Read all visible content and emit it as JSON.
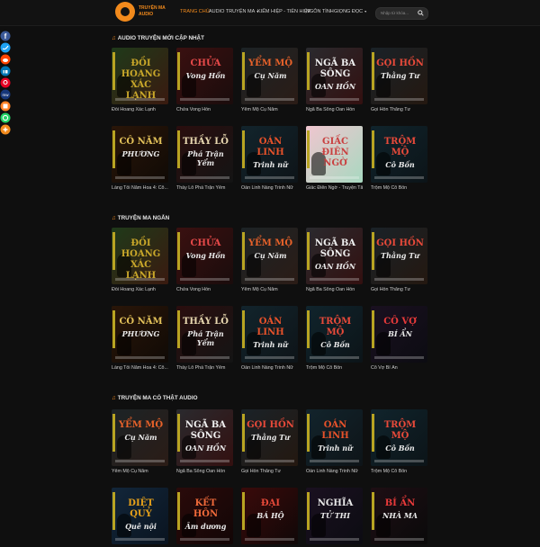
{
  "header": {
    "logo_line1": "TRUYỆN MA",
    "logo_line2": "AUDIO",
    "nav": [
      {
        "label": "TRANG CHỦ",
        "active": true,
        "dropdown": false
      },
      {
        "label": "AUDIO TRUYỆN MA",
        "active": false,
        "dropdown": true
      },
      {
        "label": "KIẾM HIỆP - TIÊN HIỆP",
        "active": false,
        "dropdown": false
      },
      {
        "label": "NGÔN TÌNH",
        "active": false,
        "dropdown": false
      },
      {
        "label": "GIỌNG ĐỌC",
        "active": false,
        "dropdown": true
      }
    ],
    "search_placeholder": "Nhập từ khóa..."
  },
  "share": [
    "facebook-icon",
    "twitter-icon",
    "reddit-icon",
    "linkedin-icon",
    "pinterest-icon",
    "mewe-icon",
    "mix-icon",
    "whatsapp-icon",
    "more-icon"
  ],
  "colors": {
    "accent": "#f28a1c",
    "background": "#0f0f0f"
  },
  "sections": [
    {
      "title": "AUDIO TRUYỆN MỚI CẬP NHẬT",
      "rows": [
        [
          {
            "caption": "Đồi Hoang Xác Lạnh",
            "art": "ĐỒI HOANG XÁC LẠNH",
            "art_sub": "",
            "color": "#c9a72a",
            "bg1": "#1f3a1a",
            "bg2": "#3a1a10"
          },
          {
            "caption": "Chửa Vong Hồn",
            "art": "CHỬA",
            "art_sub": "Vong Hồn",
            "color": "#e84a4a",
            "bg1": "#3a1010",
            "bg2": "#1a0c0c"
          },
          {
            "caption": "Yểm Mộ Cụ Năm",
            "art": "YỂM MỘ",
            "art_sub": "Cụ Năm",
            "color": "#e8622a",
            "bg1": "#1c2326",
            "bg2": "#2b1c16"
          },
          {
            "caption": "Ngã Ba Sông Oan Hồn",
            "art": "NGÃ BA SÔNG",
            "art_sub": "OAN HỒN",
            "color": "#f0f0f0",
            "bg1": "#2a2a2e",
            "bg2": "#331010"
          },
          {
            "caption": "Gọi Hồn Thằng Tư",
            "art": "GỌI HỒN",
            "art_sub": "Thằng Tư",
            "color": "#e84a3a",
            "bg1": "#1a2228",
            "bg2": "#241810"
          }
        ],
        [
          {
            "caption": "Làng Tối Năm Hoa 4: Cô...",
            "art": "CÔ NĂM",
            "art_sub": "PHƯƠNG",
            "color": "#e2c15a",
            "bg1": "#2a1608",
            "bg2": "#100a06"
          },
          {
            "caption": "Thầy Lỗ Phá Trận Yểm",
            "art": "THẦY LỖ",
            "art_sub": "Phá Trận Yểm",
            "color": "#e8d8b0",
            "bg1": "#2a0e0e",
            "bg2": "#141414"
          },
          {
            "caption": "Oán Linh Nàng Trinh Nữ",
            "art": "OÁN LINH",
            "art_sub": "Trinh nữ",
            "color": "#e8522a",
            "bg1": "#12242c",
            "bg2": "#0e1418"
          },
          {
            "caption": "Giấc Điên Ngờ - Truyện Tâ...",
            "art": "GIẤC ĐIÊN NGỜ",
            "art_sub": "",
            "color": "#c94040",
            "bg1": "#f0c6cf",
            "bg2": "#a8d8c0"
          },
          {
            "caption": "Trộm Mộ Cô Bốn",
            "art": "TRỘM MỘ",
            "art_sub": "Cô Bốn",
            "color": "#e84a3a",
            "bg1": "#10242c",
            "bg2": "#0c1418"
          }
        ]
      ]
    },
    {
      "title": "TRUYỆN MA NGẮN",
      "rows": [
        [
          {
            "caption": "Đồi Hoang Xác Lạnh",
            "art": "ĐỒI HOANG XÁC LẠNH",
            "art_sub": "",
            "color": "#c9a72a",
            "bg1": "#1f3a1a",
            "bg2": "#3a1a10"
          },
          {
            "caption": "Chửa Vong Hồn",
            "art": "CHỬA",
            "art_sub": "Vong Hồn",
            "color": "#e84a4a",
            "bg1": "#3a1010",
            "bg2": "#1a0c0c"
          },
          {
            "caption": "Yểm Mộ Cụ Năm",
            "art": "YỂM MỘ",
            "art_sub": "Cụ Năm",
            "color": "#e8622a",
            "bg1": "#1c2326",
            "bg2": "#2b1c16"
          },
          {
            "caption": "Ngã Ba Sông Oan Hồn",
            "art": "NGÃ BA SÔNG",
            "art_sub": "OAN HỒN",
            "color": "#f0f0f0",
            "bg1": "#2a2a2e",
            "bg2": "#331010"
          },
          {
            "caption": "Gọi Hồn Thằng Tư",
            "art": "GỌI HỒN",
            "art_sub": "Thằng Tư",
            "color": "#e84a3a",
            "bg1": "#1a2228",
            "bg2": "#241810"
          }
        ],
        [
          {
            "caption": "Làng Tối Năm Hoa 4: Cô...",
            "art": "CÔ NĂM",
            "art_sub": "PHƯƠNG",
            "color": "#e2c15a",
            "bg1": "#2a1608",
            "bg2": "#100a06"
          },
          {
            "caption": "Thầy Lỗ Phá Trận Yểm",
            "art": "THẦY LỖ",
            "art_sub": "Phá Trận Yểm",
            "color": "#e8d8b0",
            "bg1": "#2a0e0e",
            "bg2": "#141414"
          },
          {
            "caption": "Oán Linh Nàng Trinh Nữ",
            "art": "OÁN LINH",
            "art_sub": "Trinh nữ",
            "color": "#e8522a",
            "bg1": "#12242c",
            "bg2": "#0e1418"
          },
          {
            "caption": "Trộm Mộ Cô Bốn",
            "art": "TRỘM MỘ",
            "art_sub": "Cô Bốn",
            "color": "#e84a3a",
            "bg1": "#10242c",
            "bg2": "#0c1418"
          },
          {
            "caption": "Cô Vợ Bí Ẩn",
            "art": "CÔ VỢ",
            "art_sub": "BÍ ẨN",
            "color": "#e83a3a",
            "bg1": "#1a1020",
            "bg2": "#0c0c12"
          }
        ]
      ]
    },
    {
      "title": "TRUYỆN MA CÓ THẬT AUDIO",
      "rows": [
        [
          {
            "caption": "Yểm Mộ Cụ Năm",
            "art": "YỂM MỘ",
            "art_sub": "Cụ Năm",
            "color": "#e8622a",
            "bg1": "#1c2326",
            "bg2": "#2b1c16"
          },
          {
            "caption": "Ngã Ba Sông Oan Hồn",
            "art": "NGÃ BA SÔNG",
            "art_sub": "OAN HỒN",
            "color": "#f0f0f0",
            "bg1": "#2a2a2e",
            "bg2": "#331010"
          },
          {
            "caption": "Gọi Hồn Thằng Tư",
            "art": "GỌI HỒN",
            "art_sub": "Thằng Tư",
            "color": "#e84a3a",
            "bg1": "#1a2228",
            "bg2": "#241810"
          },
          {
            "caption": "Oán Linh Nàng Trinh Nữ",
            "art": "OÁN LINH",
            "art_sub": "Trinh nữ",
            "color": "#e8522a",
            "bg1": "#12242c",
            "bg2": "#0e1418"
          },
          {
            "caption": "Trộm Mộ Cô Bốn",
            "art": "TRỘM MỘ",
            "art_sub": "Cô Bốn",
            "color": "#e84a3a",
            "bg1": "#10242c",
            "bg2": "#0c1418"
          }
        ],
        [
          {
            "caption": "",
            "art": "DIỆT QUỶ",
            "art_sub": "Quê nội",
            "color": "#e8a21a",
            "bg1": "#12263a",
            "bg2": "#0a1420"
          },
          {
            "caption": "",
            "art": "KẾT HÔN",
            "art_sub": "Âm dương",
            "color": "#f06a3a",
            "bg1": "#2a0a0a",
            "bg2": "#120606"
          },
          {
            "caption": "",
            "art": "ĐẠI",
            "art_sub": "BÁ HỘ",
            "color": "#e84a3a",
            "bg1": "#3a0a0a",
            "bg2": "#100808"
          },
          {
            "caption": "",
            "art": "NGHĨA",
            "art_sub": "TỬ THI",
            "color": "#e8e8e8",
            "bg1": "#1a1020",
            "bg2": "#0c0c12"
          },
          {
            "caption": "",
            "art": "BÍ ẨN",
            "art_sub": "NHÀ MA",
            "color": "#e83a3a",
            "bg1": "#1e0e14",
            "bg2": "#0a0a0a"
          }
        ]
      ]
    }
  ]
}
